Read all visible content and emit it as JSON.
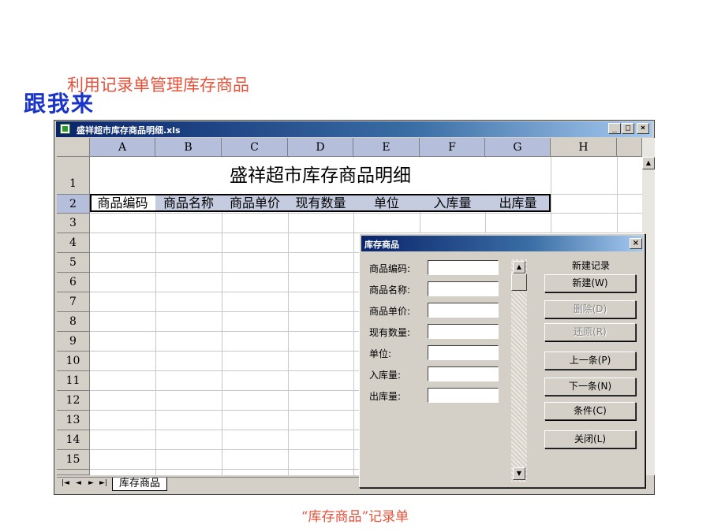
{
  "slide": {
    "subtitle": "利用记录单管理库存商品",
    "heading": "跟我来",
    "caption": "“库存商品”记录单"
  },
  "window": {
    "title": "盛祥超市库存商品明细.xls",
    "min_glyph": "_",
    "max_glyph": "□",
    "close_glyph": "×"
  },
  "sheet": {
    "columns": [
      "A",
      "B",
      "C",
      "D",
      "E",
      "F",
      "G",
      "H"
    ],
    "rows": [
      "1",
      "2",
      "3",
      "4",
      "5",
      "6",
      "7",
      "8",
      "9",
      "10",
      "11",
      "12",
      "13",
      "14",
      "15"
    ],
    "title": "盛祥超市库存商品明细",
    "headers": [
      "商品编码",
      "商品名称",
      "商品单价",
      "现有数量",
      "单位",
      "入库量",
      "出库量"
    ],
    "tab_name": "库存商品",
    "tab_nav": [
      "|◄",
      "◄",
      "►",
      "►|"
    ]
  },
  "dialog": {
    "title": "库存商品",
    "close_glyph": "×",
    "fields": [
      {
        "label": "商品编码:",
        "value": ""
      },
      {
        "label": "商品名称:",
        "value": ""
      },
      {
        "label": "商品单价:",
        "value": ""
      },
      {
        "label": "现有数量:",
        "value": ""
      },
      {
        "label": "单位:",
        "value": ""
      },
      {
        "label": "入库量:",
        "value": ""
      },
      {
        "label": "出库量:",
        "value": ""
      }
    ],
    "record_status": "新建记录",
    "buttons": {
      "new": "新建(W)",
      "delete": "删除(D)",
      "restore": "还原(R)",
      "prev": "上一条(P)",
      "next": "下一条(N)",
      "criteria": "条件(C)",
      "close": "关闭(L)"
    },
    "scroll_up": "▲",
    "scroll_down": "▼"
  },
  "colors": {
    "title_bar": "#0a246a",
    "heading_text": "#1a34c8",
    "subtitle_text": "#e8523a",
    "selected_header": "#b5bedb"
  }
}
